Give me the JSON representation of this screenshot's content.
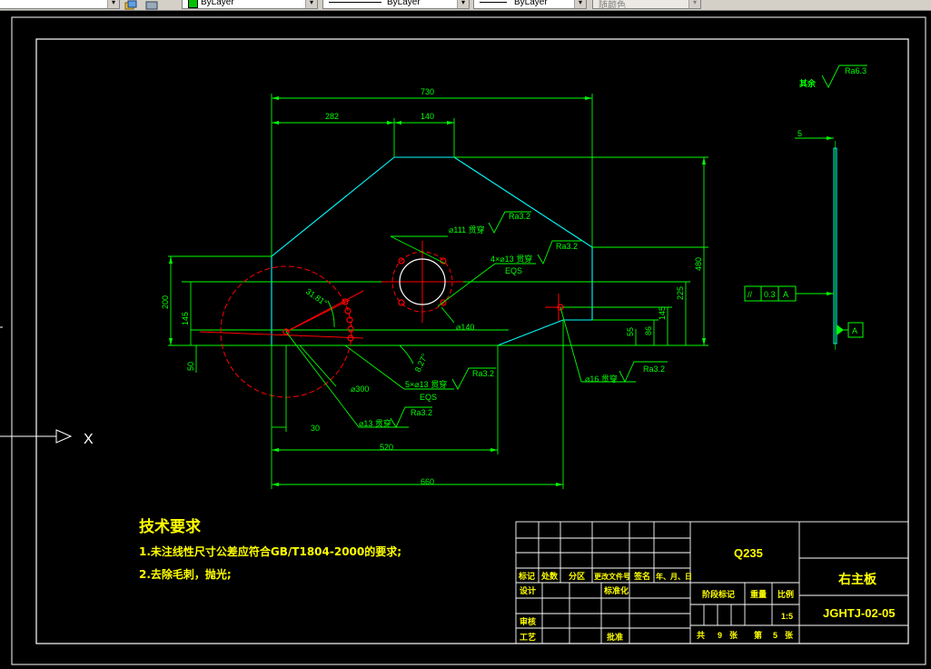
{
  "toolbar": {
    "color_combo": "ByLayer",
    "linetype_combo": "ByLayer",
    "lineweight_combo": "ByLayer",
    "plotstyle_combo": "随颜色",
    "layer_arrow": "▾"
  },
  "colors": {
    "background": "#000000",
    "frame": "#ffffff",
    "outline": "#00ffff",
    "dimension": "#00ff00",
    "center": "#ff0000",
    "text": "#ffff00"
  },
  "ucs": {
    "x_label": "X"
  },
  "drawing": {
    "dims": {
      "d730": "730",
      "d282": "282",
      "d140": "140",
      "d480": "480",
      "d225": "225",
      "d200": "200",
      "d145": "145",
      "d145b": "145",
      "d86": "86",
      "d55": "55",
      "d50": "50",
      "d30": "30",
      "d520": "520",
      "d660": "660",
      "angle1": "31.81°",
      "angle2": "8.27°",
      "dia300": "⌀300",
      "dia140": "⌀140"
    },
    "callouts": {
      "hole111": "⌀111 贯穿",
      "ra111": "Ra3.2",
      "holes4": "4×⌀13 贯穿",
      "eqs4": "EQS",
      "ra4": "Ra3.2",
      "holes5": "5×⌀13 贯穿",
      "eqs5": "EQS",
      "ra5": "Ra3.2",
      "hole13": "⌀13 贯穿",
      "ra13": "Ra3.2",
      "hole16": "⌀16 贯穿",
      "ra16": "Ra3.2"
    },
    "side_view": {
      "thickness": "5",
      "remaining_label": "其余",
      "remaining_ra": "Ra6.3",
      "tol_symbol": "//",
      "tol_value": "0.3",
      "tol_datum": "A",
      "datum": "A"
    }
  },
  "tech": {
    "title": "技术要求",
    "line1": "1.未注线性尺寸公差应符合GB/T1804-2000的要求;",
    "line2": "2.去除毛刺，抛光;"
  },
  "title_block": {
    "material": "Q235",
    "part_name": "右主板",
    "drawing_no": "JGHTJ-02-05",
    "scale": "1:5",
    "h_mark": "标记",
    "h_count": "处数",
    "h_zone": "分区",
    "h_docno": "更改文件号",
    "h_sign": "签名",
    "h_date": "年、月、日",
    "r_design": "设计",
    "r_std": "标准化",
    "r_review": "审核",
    "r_process": "工艺",
    "r_approve": "批准",
    "h_stage": "阶段标记",
    "h_weight": "重量",
    "h_scale": "比例",
    "sheet_total_prefix": "共",
    "sheet_total": "9",
    "sheet_total_suffix": "张",
    "sheet_no_prefix": "第",
    "sheet_no": "5",
    "sheet_no_suffix": "张"
  }
}
